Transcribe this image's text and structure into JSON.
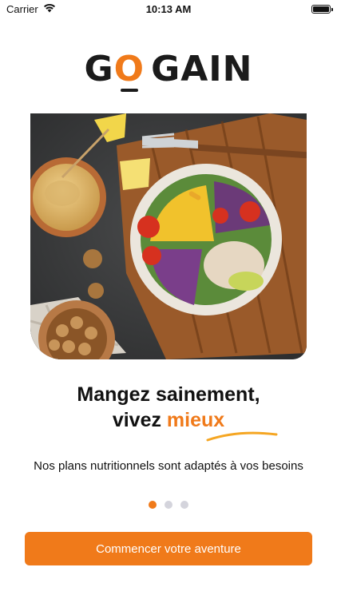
{
  "status_bar": {
    "carrier": "Carrier",
    "time": "10:13 AM",
    "wifi_icon": "wifi-icon",
    "battery_icon": "battery-full-icon"
  },
  "logo": {
    "part1": "G",
    "part2": "O",
    "part3": "GAIN"
  },
  "hero_image": {
    "subject": "salad bowl with hummus and walnuts on wooden board"
  },
  "headline": {
    "line1": "Mangez sainement,",
    "line2_prefix": "vivez ",
    "line2_accent": "mieux"
  },
  "subtitle": "Nos plans nutritionnels sont adaptés à vos besoins",
  "pagination": {
    "count": 3,
    "active_index": 0
  },
  "cta": {
    "label": "Commencer votre aventure"
  },
  "colors": {
    "accent": "#f07a1a",
    "text": "#111111",
    "dot_inactive": "#d4d4dc"
  }
}
